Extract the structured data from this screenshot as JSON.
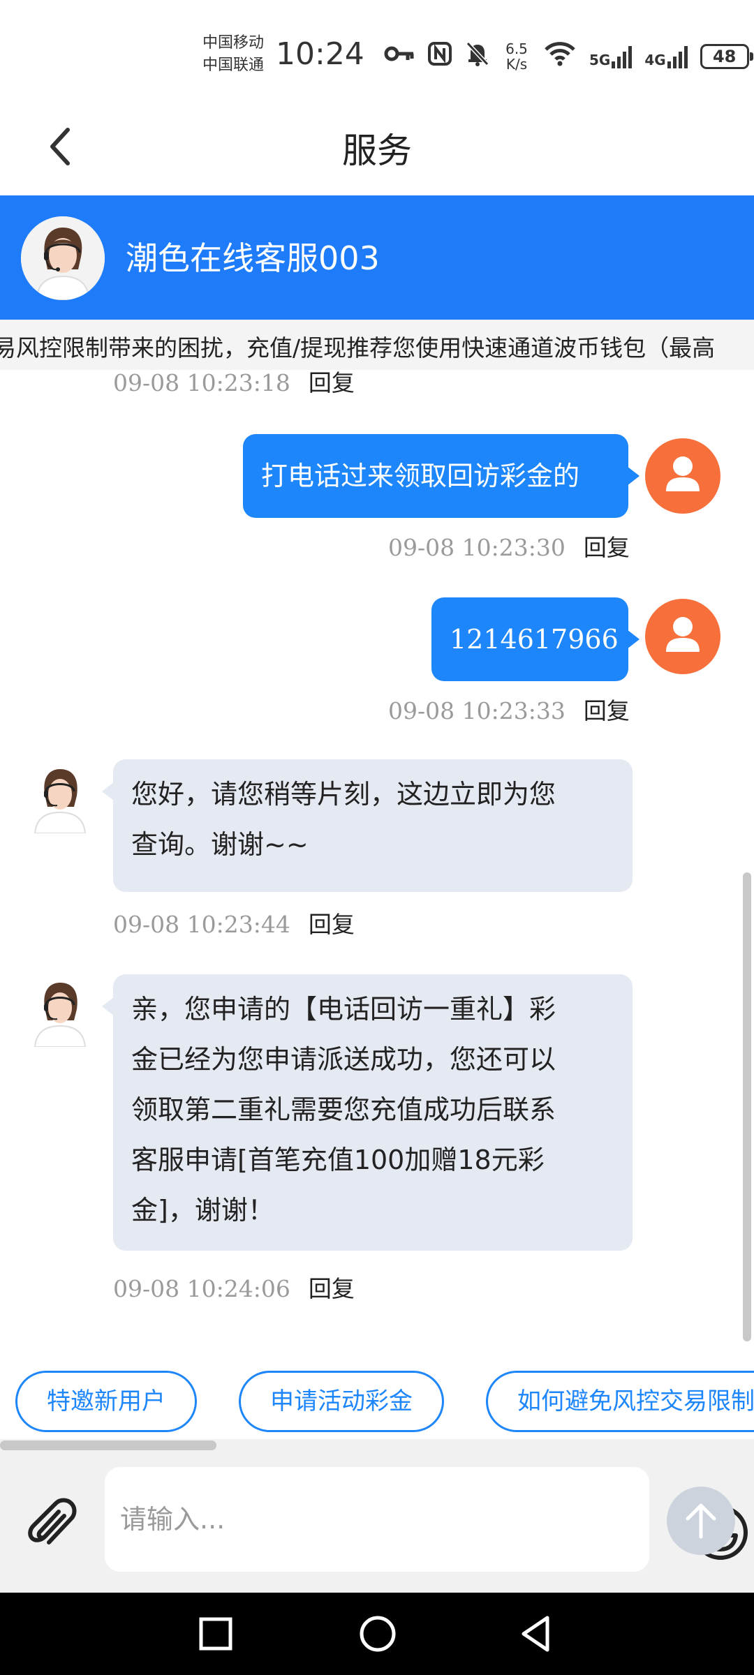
{
  "status_bar": {
    "carrier1": "中国移动",
    "carrier2": "中国联通",
    "time": "10:24",
    "net_speed_value": "6.5",
    "net_speed_unit": "K/s",
    "signal1": "5G",
    "signal2": "4G",
    "battery": "48"
  },
  "header": {
    "title": "服务"
  },
  "agent": {
    "name": "潮色在线客服003"
  },
  "marquee": {
    "text": "易风控限制带来的困扰，充值/提现推荐您使用快速通道波币钱包（最高"
  },
  "messages": [
    {
      "time": "09-08 10:23:18",
      "reply": "回复"
    },
    {
      "text": "打电话过来领取回访彩金的",
      "time": "09-08 10:23:30",
      "reply": "回复"
    },
    {
      "text": "1214617966",
      "time": "09-08 10:23:33",
      "reply": "回复"
    },
    {
      "line1": "您好，请您稍等片刻，这边立即为您",
      "line2": "查询。谢谢~~",
      "time": "09-08 10:23:44",
      "reply": "回复"
    },
    {
      "line1": "亲，您申请的【电话回访一重礼】彩",
      "line2": "金已经为您申请派送成功，您还可以",
      "line3": "领取第二重礼需要您充值成功后联系",
      "line4": "客服申请[首笔充值100加赠18元彩",
      "line5": "金]，谢谢！",
      "time": "09-08 10:24:06",
      "reply": "回复"
    }
  ],
  "quick_replies": [
    "特邀新用户",
    "申请活动彩金",
    "如何避免风控交易限制"
  ],
  "input": {
    "placeholder": "请输入..."
  },
  "colors": {
    "primary": "#1e7cfb",
    "bubble_out": "#1e86fb",
    "bubble_in": "#e5e9f2",
    "user_avatar": "#f76f3a"
  }
}
